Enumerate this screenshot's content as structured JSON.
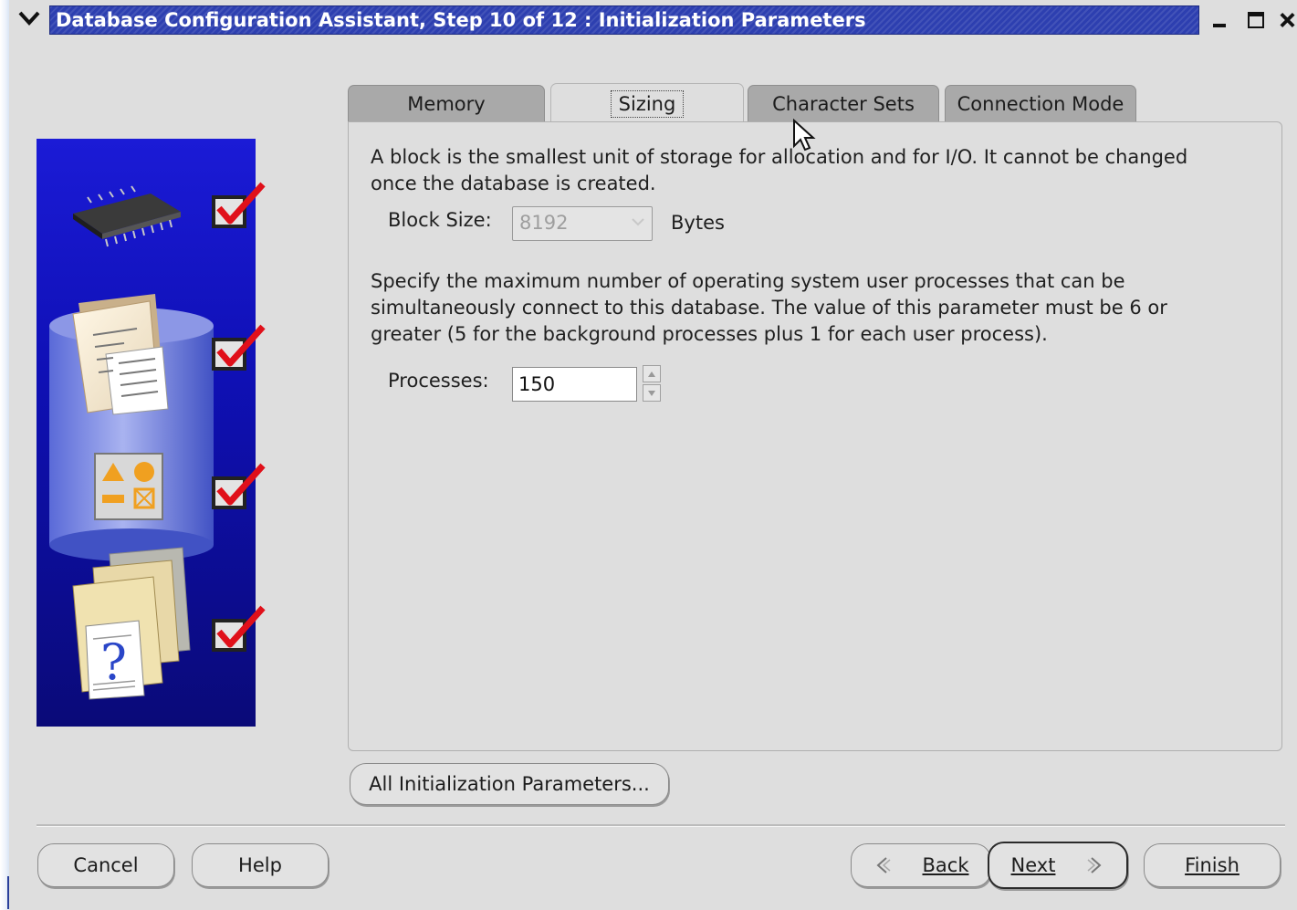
{
  "window": {
    "title": "Database Configuration Assistant, Step 10 of 12 : Initialization Parameters"
  },
  "tabs": [
    {
      "label": "Memory",
      "active": false
    },
    {
      "label": "Sizing",
      "active": true
    },
    {
      "label": "Character Sets",
      "active": false
    },
    {
      "label": "Connection Mode",
      "active": false
    }
  ],
  "sizing": {
    "block_description": "A block is the smallest unit of storage for allocation and for I/O. It cannot be changed\nonce the database is created.",
    "block_size_label": "Block Size:",
    "block_size_value": "8192",
    "block_size_unit": "Bytes",
    "processes_description": "Specify the maximum number of operating system user processes that can be\nsimultaneously connect to this database. The value of this parameter must be 6 or\ngreater (5 for the background processes plus 1 for each user process).",
    "processes_label": "Processes:",
    "processes_value": "150"
  },
  "buttons": {
    "all_params": "All Initialization Parameters...",
    "cancel": "Cancel",
    "help": "Help",
    "back": "Back",
    "next": "Next",
    "finish": "Finish"
  },
  "colors": {
    "title_bar": "#2d3fb0",
    "graphic_panel": "#1414c8",
    "check_mark": "#e0101a",
    "window_bg": "#dedede"
  }
}
